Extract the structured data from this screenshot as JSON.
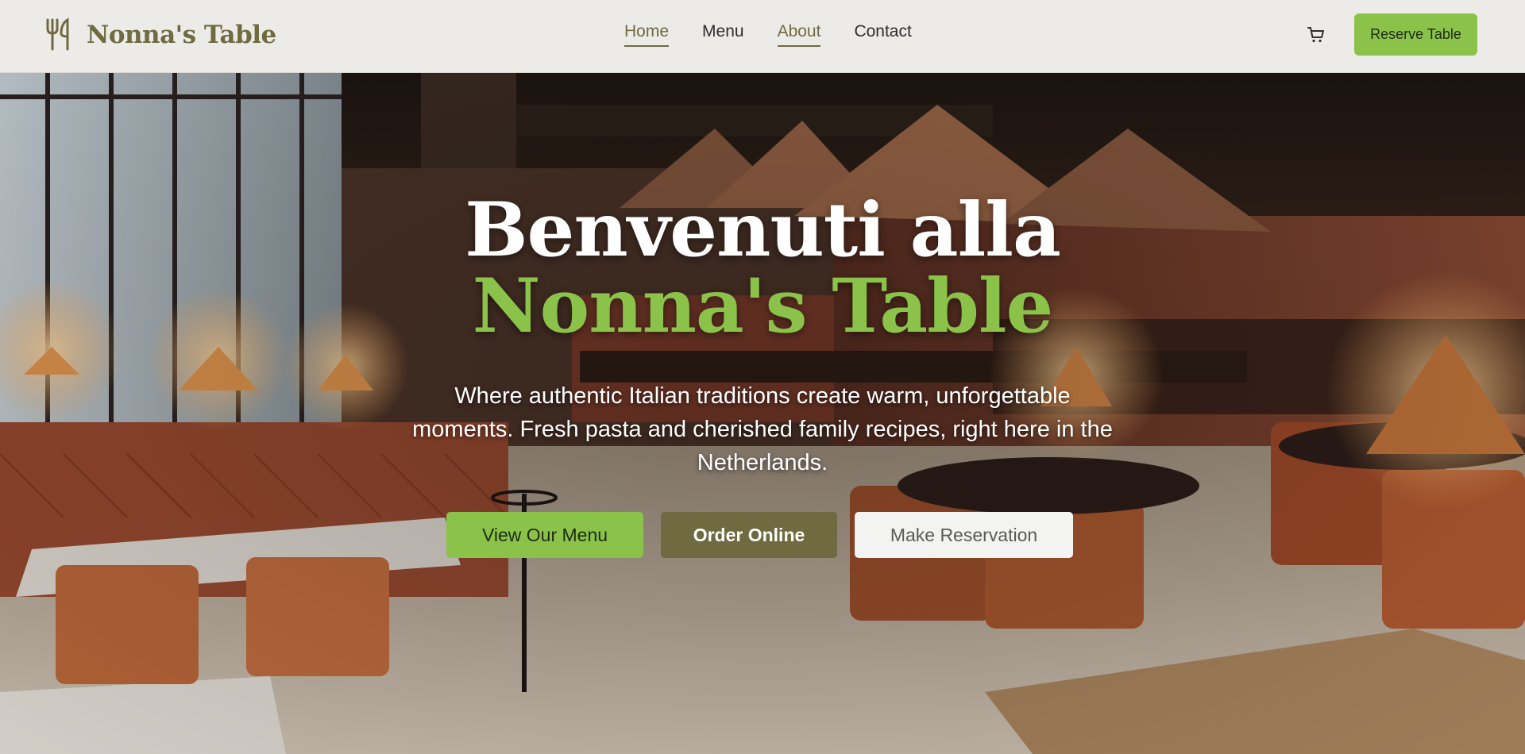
{
  "header": {
    "logo_text": "Nonna's Table",
    "logo_icon": "fork-knife-icon",
    "nav": [
      {
        "label": "Home",
        "active": true
      },
      {
        "label": "Menu",
        "active": false
      },
      {
        "label": "About",
        "active": true
      },
      {
        "label": "Contact",
        "active": false
      }
    ],
    "cart_icon": "shopping-cart-icon",
    "reserve_label": "Reserve Table"
  },
  "hero": {
    "title_line1": "Benvenuti alla",
    "title_line2": "Nonna's Table",
    "subtitle": "Where authentic Italian traditions create warm, unforgettable moments. Fresh pasta and cherished family recipes, right here in the Netherlands.",
    "buttons": {
      "view_menu": "View Our Menu",
      "order_online": "Order Online",
      "make_reservation": "Make Reservation"
    }
  },
  "colors": {
    "accent_green": "#8bc34a",
    "olive": "#6f6a3f",
    "header_bg": "#ecebe8",
    "light_button": "#f3f3f1"
  }
}
